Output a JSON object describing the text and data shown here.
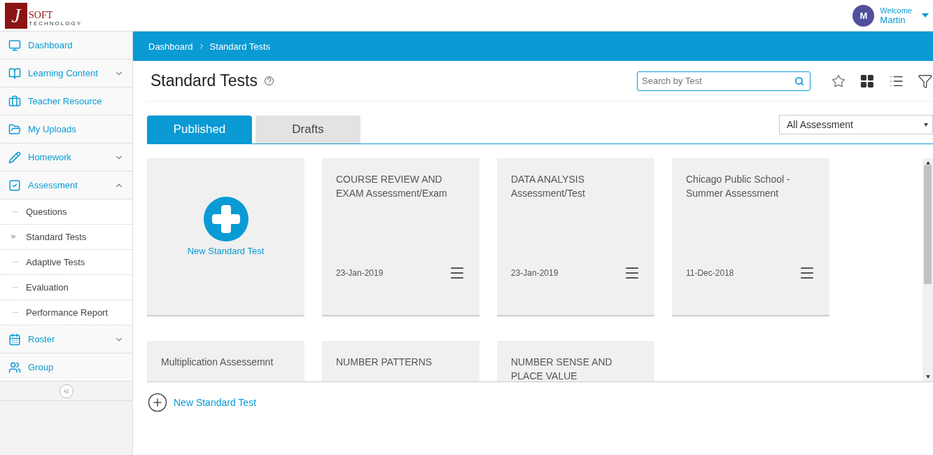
{
  "logo": {
    "letter": "J",
    "name": "SOFT",
    "tagline": "TECHNOLOGY"
  },
  "user": {
    "initial": "M",
    "greeting": "Welcome",
    "name": "Martin"
  },
  "sidebar": {
    "items": [
      {
        "kind": "monitor",
        "label": "Dashboard",
        "expandable": false
      },
      {
        "kind": "book",
        "label": "Learning Content",
        "expandable": true,
        "expanded": false
      },
      {
        "kind": "briefcase",
        "label": "Teacher Resource",
        "expandable": false
      },
      {
        "kind": "folder",
        "label": "My Uploads",
        "expandable": false
      },
      {
        "kind": "pencil",
        "label": "Homework",
        "expandable": true,
        "expanded": false
      },
      {
        "kind": "checkbox",
        "label": "Assessment",
        "expandable": true,
        "expanded": true,
        "children": [
          {
            "label": "Questions",
            "selected": false
          },
          {
            "label": "Standard Tests",
            "selected": true
          },
          {
            "label": "Adaptive Tests",
            "selected": false
          },
          {
            "label": "Evaluation",
            "selected": false
          },
          {
            "label": "Performance Report",
            "selected": false
          }
        ]
      },
      {
        "kind": "calendar",
        "label": "Roster",
        "expandable": true,
        "expanded": false
      },
      {
        "kind": "people",
        "label": "Group",
        "expandable": false
      }
    ]
  },
  "breadcrumb": [
    "Dashboard",
    "Standard Tests"
  ],
  "page_title": "Standard Tests",
  "search": {
    "placeholder": "Search by Test"
  },
  "tabs": [
    {
      "label": "Published",
      "selected": true
    },
    {
      "label": "Drafts",
      "selected": false
    }
  ],
  "filter": {
    "value": "All Assessment"
  },
  "cards": [
    {
      "kind": "new",
      "label": "New Standard Test"
    },
    {
      "kind": "test",
      "title": "COURSE REVIEW AND EXAM Assessment/Exam",
      "date": "23-Jan-2019"
    },
    {
      "kind": "test",
      "title": "DATA ANALYSIS Assessment/Test",
      "date": "23-Jan-2019"
    },
    {
      "kind": "test",
      "title": "Chicago Public School - Summer Assessment",
      "date": "11-Dec-2018"
    },
    {
      "kind": "test",
      "title": "Multiplication Assessemnt"
    },
    {
      "kind": "test",
      "title": "NUMBER PATTERNS"
    },
    {
      "kind": "test",
      "title": "NUMBER SENSE AND PLACE VALUE"
    }
  ],
  "footer_link": "New Standard Test"
}
